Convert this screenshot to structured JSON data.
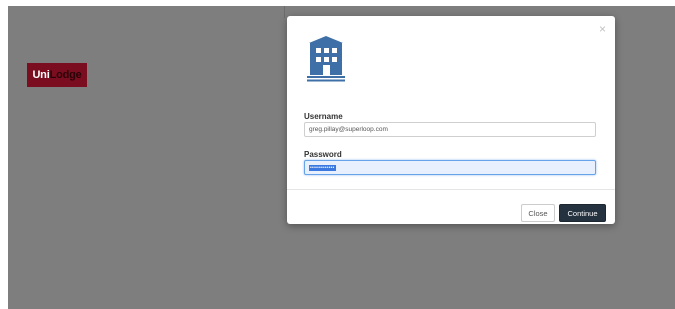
{
  "brand": {
    "logo_part1": "Uni",
    "logo_part2": "Lodge"
  },
  "modal": {
    "close_symbol": "×",
    "icon": "building-icon",
    "username": {
      "label": "Username",
      "value": "greg.pillay@superloop.com"
    },
    "password": {
      "label": "Password",
      "masked_value": "••••••••••••"
    },
    "buttons": {
      "close_label": "Close",
      "continue_label": "Continue"
    }
  },
  "colors": {
    "backdrop": "#7e7e7e",
    "brand_red": "#7a0e20",
    "icon_blue": "#3e6fa6",
    "primary_button": "#24313f",
    "focus_border": "#66a3e8"
  }
}
